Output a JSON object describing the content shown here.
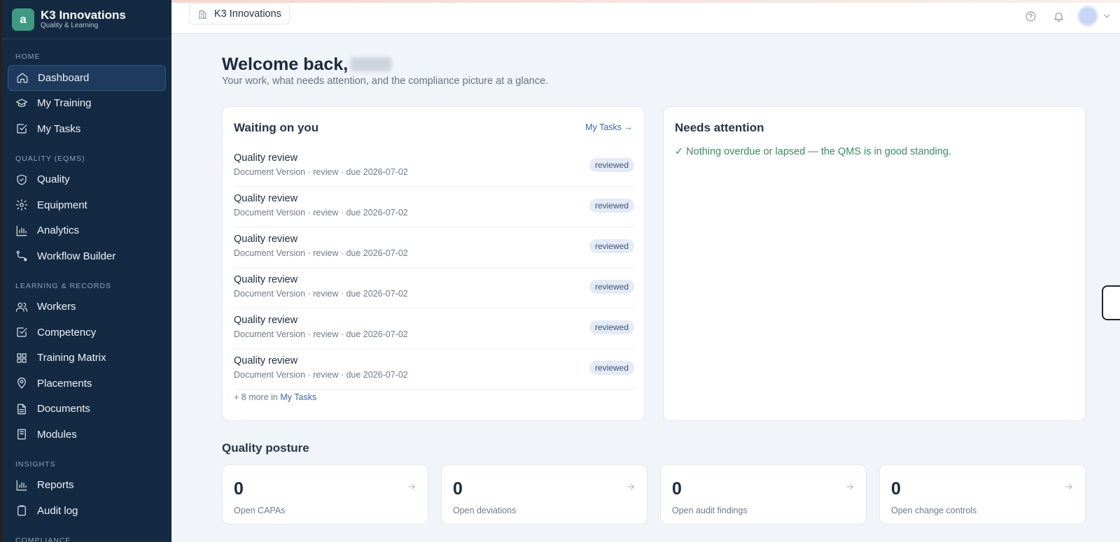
{
  "brand": {
    "logo_letter": "a",
    "name": "K3 Innovations",
    "tagline": "Quality & Learning"
  },
  "sidebar": {
    "sections": [
      {
        "title": "HOME",
        "items": [
          {
            "label": "Dashboard",
            "icon": "home-icon",
            "active": true
          },
          {
            "label": "My Training",
            "icon": "graduation-cap-icon"
          },
          {
            "label": "My Tasks",
            "icon": "checkbox-icon"
          }
        ]
      },
      {
        "title": "QUALITY (EQMS)",
        "items": [
          {
            "label": "Quality",
            "icon": "shield-check-icon"
          },
          {
            "label": "Equipment",
            "icon": "gear-icon"
          },
          {
            "label": "Analytics",
            "icon": "bar-chart-icon"
          },
          {
            "label": "Workflow Builder",
            "icon": "workflow-icon"
          }
        ]
      },
      {
        "title": "LEARNING & RECORDS",
        "items": [
          {
            "label": "Workers",
            "icon": "users-icon"
          },
          {
            "label": "Competency",
            "icon": "checkbox-icon"
          },
          {
            "label": "Training Matrix",
            "icon": "grid-icon"
          },
          {
            "label": "Placements",
            "icon": "map-pin-icon"
          },
          {
            "label": "Documents",
            "icon": "document-icon"
          },
          {
            "label": "Modules",
            "icon": "book-icon"
          }
        ]
      },
      {
        "title": "INSIGHTS",
        "items": [
          {
            "label": "Reports",
            "icon": "bar-chart-icon"
          },
          {
            "label": "Audit log",
            "icon": "clipboard-icon"
          }
        ]
      },
      {
        "title": "COMPLIANCE",
        "items": []
      }
    ]
  },
  "topbar": {
    "org_name": "K3 Innovations"
  },
  "welcome": {
    "heading": "Welcome back,",
    "subtitle": "Your work, what needs attention, and the compliance picture at a glance."
  },
  "waiting": {
    "title": "Waiting on you",
    "link": "My Tasks →",
    "tasks": [
      {
        "title": "Quality review",
        "meta": "Document Version · review · due 2026-07-02",
        "status": "reviewed"
      },
      {
        "title": "Quality review",
        "meta": "Document Version · review · due 2026-07-02",
        "status": "reviewed"
      },
      {
        "title": "Quality review",
        "meta": "Document Version · review · due 2026-07-02",
        "status": "reviewed"
      },
      {
        "title": "Quality review",
        "meta": "Document Version · review · due 2026-07-02",
        "status": "reviewed"
      },
      {
        "title": "Quality review",
        "meta": "Document Version · review · due 2026-07-02",
        "status": "reviewed"
      },
      {
        "title": "Quality review",
        "meta": "Document Version · review · due 2026-07-02",
        "status": "reviewed"
      }
    ],
    "more_prefix": "+ 8 more in",
    "more_link": "My Tasks"
  },
  "attention": {
    "title": "Needs attention",
    "message": "✓ Nothing overdue or lapsed — the QMS is in good standing."
  },
  "posture": {
    "title": "Quality posture",
    "stats": [
      {
        "value": "0",
        "label": "Open CAPAs"
      },
      {
        "value": "0",
        "label": "Open deviations"
      },
      {
        "value": "0",
        "label": "Open audit findings"
      },
      {
        "value": "0",
        "label": "Open change controls"
      }
    ]
  },
  "colors": {
    "sidebar_bg": "#142a42",
    "accent_link": "#3a66b0",
    "success_text": "#3f8a63",
    "brand_logo": "#3e9a82"
  }
}
